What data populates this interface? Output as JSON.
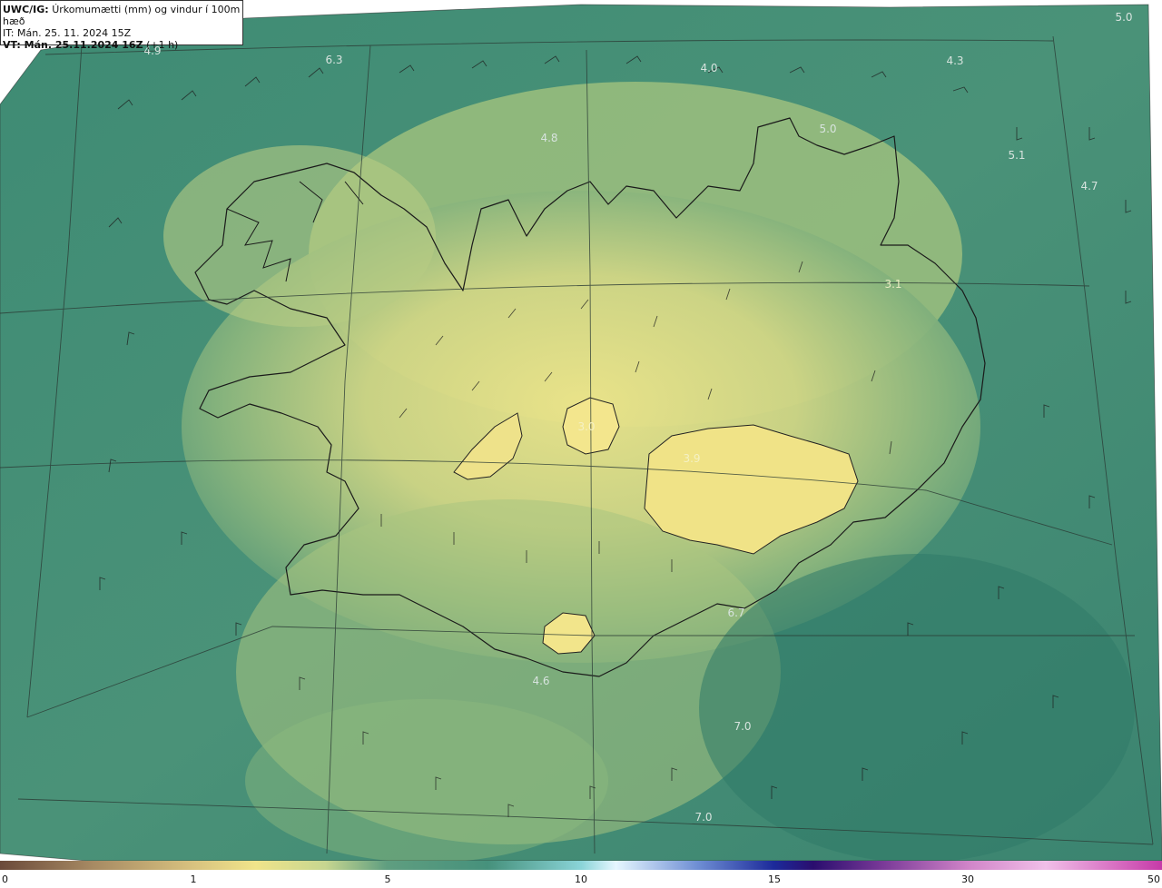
{
  "header": {
    "model": "UWC/IG:",
    "title": "Úrkomumætti (mm) og vindur í 100m hæð",
    "it_line": "IT: Mán. 25. 11. 2024 15Z",
    "vt_label": "VT: Mán. 25.11.2024 16Z",
    "vt_offset": "(+1 h)"
  },
  "map_labels": [
    {
      "text": "4.9"
    },
    {
      "text": "6.3"
    },
    {
      "text": "4.0"
    },
    {
      "text": "4.3"
    },
    {
      "text": "5.0"
    },
    {
      "text": "4.8"
    },
    {
      "text": "5.0"
    },
    {
      "text": "5.1"
    },
    {
      "text": "4.7"
    },
    {
      "text": "6.7"
    },
    {
      "text": "4.6"
    },
    {
      "text": "7.0"
    },
    {
      "text": "7.0"
    },
    {
      "text": "3.1"
    },
    {
      "text": "3.0"
    },
    {
      "text": "3.9"
    }
  ],
  "colorbar": {
    "ticks": [
      "0",
      "1",
      "5",
      "10",
      "15",
      "30",
      "50"
    ],
    "colors": [
      "#6b4a3a",
      "#c9b07a",
      "#f0e48a",
      "#c7d690",
      "#5f9e80",
      "#3f8b79",
      "#8ad4d8",
      "#e6f6ff",
      "#6f8fd4",
      "#1c2a9a",
      "#2a0e6e",
      "#7a3a98",
      "#d084c8",
      "#f1bfe8",
      "#c63aa8"
    ]
  }
}
